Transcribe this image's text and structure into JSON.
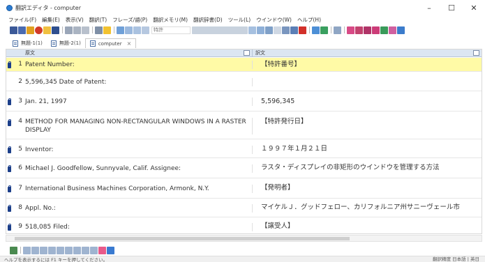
{
  "window": {
    "title": "翻訳エディタ - computer",
    "minimize": "–",
    "maximize": "☐",
    "close": "✕"
  },
  "menu": [
    "ファイル(F)",
    "編集(E)",
    "表示(V)",
    "翻訳(T)",
    "フレーズ/語(P)",
    "翻訳メモリ(M)",
    "翻訳辞書(D)",
    "ツール(L)",
    "ウインドウ(W)",
    "ヘルプ(H)"
  ],
  "toolbar": {
    "search_value": "特許"
  },
  "tabs": [
    {
      "label": "無題-1(1)",
      "active": false
    },
    {
      "label": "無題-2(1)",
      "active": false
    },
    {
      "label": "computer",
      "active": true,
      "close": "×"
    }
  ],
  "grid": {
    "source_header": "原文",
    "target_header": "訳文",
    "rows": [
      {
        "num": "1",
        "source": "Patent Number:",
        "target": "【特許番号】"
      },
      {
        "num": "2",
        "source": "5,596,345 Date of Patent:",
        "target": ""
      },
      {
        "num": "3",
        "source": "Jan. 21, 1997",
        "target": "5,596,345"
      },
      {
        "num": "4",
        "source": "METHOD FOR MANAGING NON-RECTANGULAR WINDOWS IN A RASTER DISPLAY",
        "target": "【特許発行日】"
      },
      {
        "num": "5",
        "source": "Inventor:",
        "target": "１９９７年１月２１日"
      },
      {
        "num": "6",
        "source": "Michael J. Goodfellow, Sunnyvale, Calif. Assignee:",
        "target": "ラスタ・ディスプレイの非矩形のウインドウを管理する方法"
      },
      {
        "num": "7",
        "source": "International Business Machines Corporation, Armonk, N.Y.",
        "target": "【発明者】"
      },
      {
        "num": "8",
        "source": "Appl. No.:",
        "target": "マイケルＪ．グッドフェロー、カリフォルニア州サニーヴェール市"
      },
      {
        "num": "9",
        "source": "518,085 Filed:",
        "target": "【譲受人】"
      }
    ]
  },
  "status": {
    "left": "ヘルプを表示するには F1 キーを押してください。",
    "right": "翻訳精度 日本語 | 英日"
  }
}
